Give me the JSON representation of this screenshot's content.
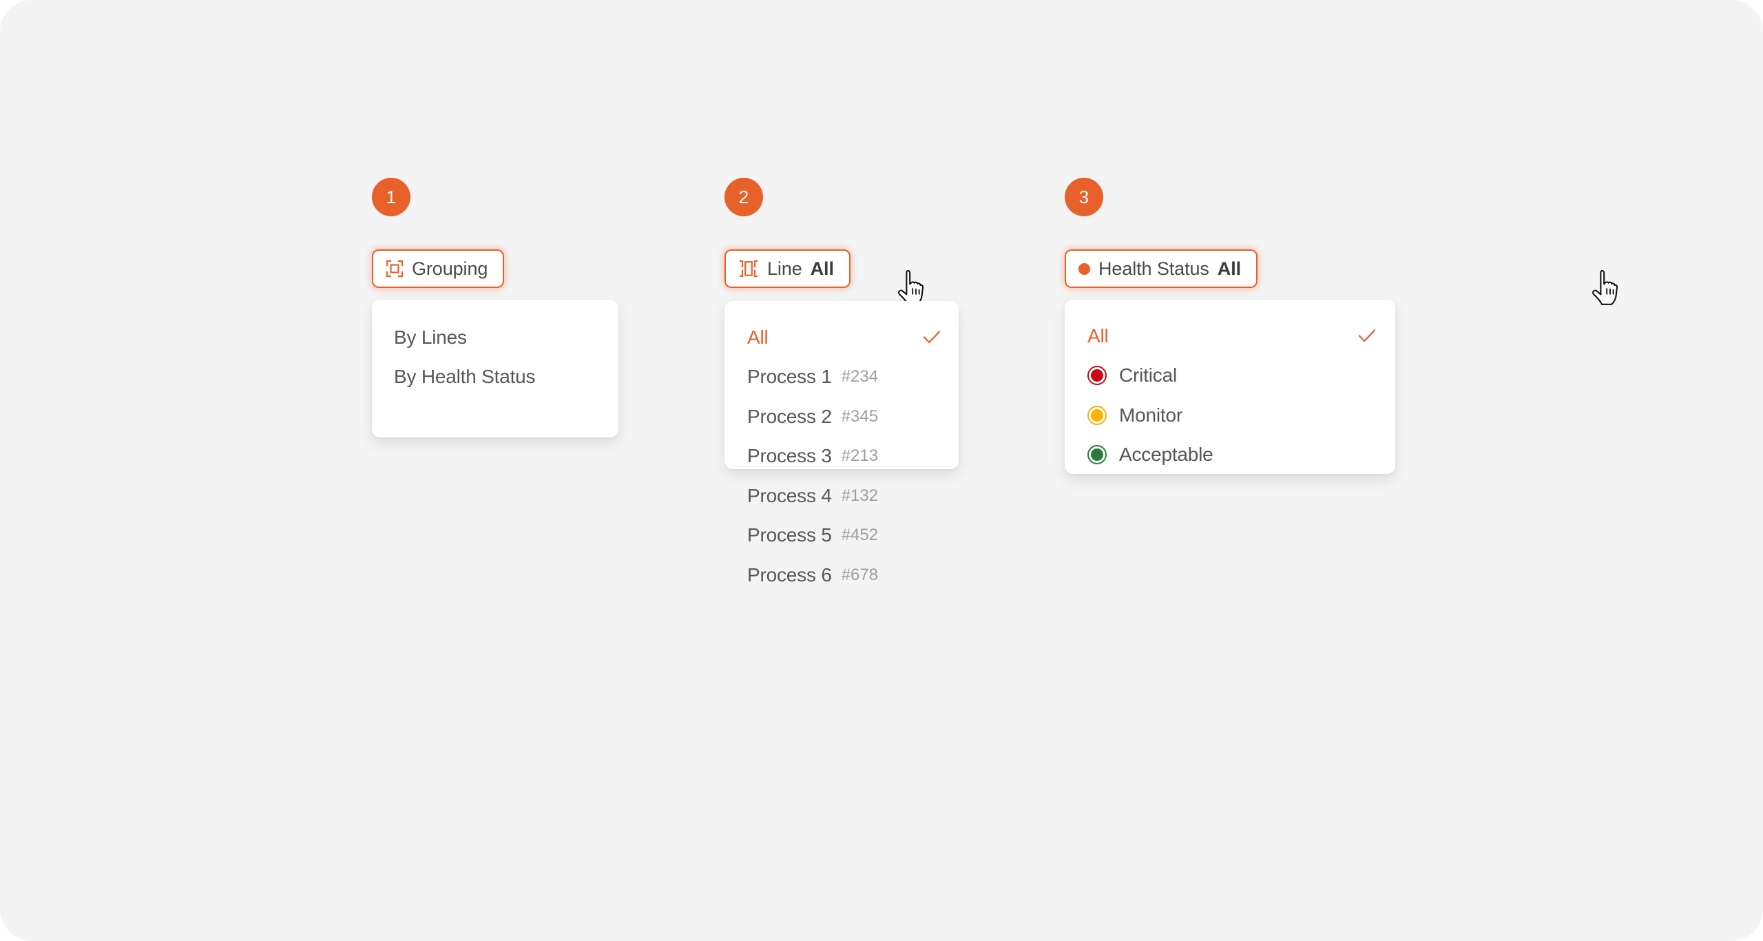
{
  "theme": {
    "background": "#f4f4f4",
    "accent": "#e8612a",
    "accent_text": "#ef5f26",
    "panel_background": "#ffffff",
    "label_text": "#575757",
    "code_text": "#9e9e9e"
  },
  "steps": [
    {
      "number": "1",
      "trigger": {
        "icon": "grouping-brackets-icon",
        "label": "Grouping",
        "value": ""
      },
      "menu": {
        "items": [
          {
            "label": "By Lines",
            "selected": false
          },
          {
            "label": "By Health Status",
            "selected": false
          }
        ]
      }
    },
    {
      "number": "2",
      "trigger": {
        "icon": "production-line-icon",
        "label": "Line",
        "value": "All"
      },
      "menu": {
        "items": [
          {
            "label": "All",
            "code": "",
            "selected": true
          },
          {
            "label": "Process 1",
            "code": "#234",
            "selected": false
          },
          {
            "label": "Process 2",
            "code": "#345",
            "selected": false
          },
          {
            "label": "Process 3",
            "code": "#213",
            "selected": false
          },
          {
            "label": "Process 4",
            "code": "#132",
            "selected": false
          },
          {
            "label": "Process 5",
            "code": "#452",
            "selected": false
          },
          {
            "label": "Process 6",
            "code": "#678",
            "selected": false
          }
        ]
      }
    },
    {
      "number": "3",
      "trigger": {
        "icon": "status-dot-icon",
        "label": "Health Status",
        "value": "All"
      },
      "menu": {
        "items": [
          {
            "label": "All",
            "color": "",
            "selected": true
          },
          {
            "label": "Critical",
            "color": "#cc0714",
            "selected": false
          },
          {
            "label": "Monitor",
            "color": "#ffb100",
            "selected": false
          },
          {
            "label": "Acceptable",
            "color": "#2b7c3a",
            "selected": false
          }
        ]
      }
    }
  ]
}
